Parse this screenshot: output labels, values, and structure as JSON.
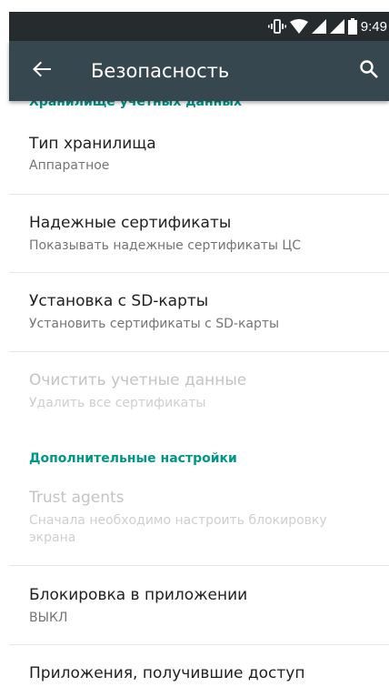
{
  "status_bar": {
    "time": "9:49",
    "icons": [
      "vibrate-icon",
      "wifi-icon",
      "signal-icon",
      "signal-icon",
      "battery-icon"
    ]
  },
  "toolbar": {
    "title": "Безопасность",
    "back_icon": "arrow-back-icon",
    "search_icon": "search-icon"
  },
  "sections": {
    "storage_header": "Хранилище учетных данных",
    "advanced_header": "Дополнительные настройки"
  },
  "items": [
    {
      "title": "Тип хранилища",
      "summary": "Аппаратное",
      "enabled": true
    },
    {
      "title": "Надежные сертификаты",
      "summary": "Показывать надежные сертификаты ЦС",
      "enabled": true
    },
    {
      "title": "Установка с SD-карты",
      "summary": "Установить сертификаты с SD-карты",
      "enabled": true
    },
    {
      "title": "Очистить учетные данные",
      "summary": "Удалить все сертификаты",
      "enabled": false
    },
    {
      "title": "Trust agents",
      "summary": "Сначала необходимо настроить блокировку экрана",
      "enabled": false
    },
    {
      "title": "Блокировка в приложении",
      "summary": "ВЫКЛ",
      "enabled": true
    },
    {
      "title": "Приложения, получившие доступ",
      "summary": "",
      "enabled": true
    }
  ],
  "colors": {
    "status_bar": "#262c2e",
    "toolbar": "#37474f",
    "accent": "#009688",
    "title_text": "#212121",
    "summary_text": "#757575",
    "disabled_text": "#c4c4c4"
  }
}
